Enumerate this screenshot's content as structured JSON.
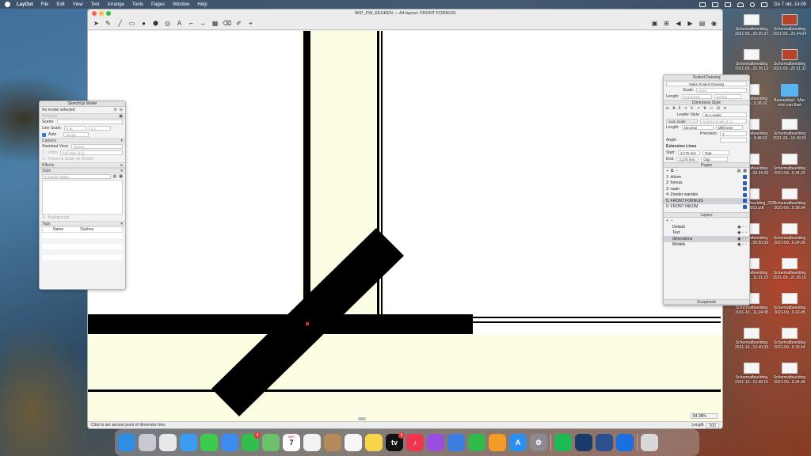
{
  "menubar": {
    "items": [
      "LayOut",
      "File",
      "Edit",
      "View",
      "Text",
      "Arrange",
      "Tools",
      "Pages",
      "Window",
      "Help"
    ],
    "clock": "Do 7 okt.  14:05"
  },
  "window": {
    "title": "SKP_FW_KEUKEN — A4.layout- FRONT FORNUIS",
    "status": "Click to set second point of dimension line.",
    "length_label": "Length",
    "length_value": "600",
    "zoom": "84.98%"
  },
  "sketchup_panel": {
    "title": "SketchUp Model",
    "model_status": "No model selected",
    "viewport": "Viewport",
    "scene_label": "Scene:",
    "line_scale_label": "Line Scale:",
    "line_scale_a": "0 pt",
    "line_scale_b": "1 x",
    "auto_label": "Auto",
    "render_mode": "Vector",
    "camera": "Camera",
    "standard_view_label": "Standard View:",
    "standard_view": "(None)",
    "ortho_label": "Ortho",
    "ortho_value": "Full Size (1:1)",
    "preserve_scale": "Preserve Scale on Resize",
    "effects": "Effects",
    "style": "Style",
    "style_value": "In Model Styles",
    "background": "Background",
    "tags": "Tags",
    "tags_col_name": "Name",
    "tags_col_dashes": "Dashes"
  },
  "scaled_drawing": {
    "title": "Scaled Drawing",
    "button": "Make Scaled Drawing",
    "scale_label": "Scale:",
    "scale_value": "None",
    "length_label": "Length:",
    "length_value": "Fractional",
    "length_unit": "Inches"
  },
  "dimension_style": {
    "title": "Dimension Style",
    "leader_label": "Leader Style:",
    "leader_value": "No Leader",
    "auto_scale": "Auto Scale",
    "current_scale": "Current Scale (1:1)",
    "length_label": "Length:",
    "length_format": "Decimal",
    "length_unit": "Millimeter",
    "precision_label": "Precision:",
    "precision_value": "1",
    "angle_label": "Angle:",
    "ext_title": "Extension Lines",
    "start_label": "Start:",
    "start_value": "3,175 mm",
    "start_mode": "Gap",
    "end_label": "End:",
    "end_value": "3,175 mm",
    "end_mode": "Gap"
  },
  "pages": {
    "title": "Pages",
    "items": [
      {
        "label": "1:  inkom"
      },
      {
        "label": "2:  fornuis"
      },
      {
        "label": "3:  raam"
      },
      {
        "label": "4:  Zonder wanden"
      },
      {
        "label": "5:  FRONT FORNUIS"
      },
      {
        "label": "6:  FRONT INKOM"
      }
    ],
    "selected_index": 4
  },
  "layers": {
    "title": "Layers",
    "items": [
      {
        "label": "Default"
      },
      {
        "label": "Text"
      },
      {
        "label": "dimensions"
      },
      {
        "label": "Models"
      }
    ],
    "selected_index": 2
  },
  "scrapbook": {
    "title": "Scrapbook"
  },
  "desktop_icons": [
    {
      "label": "Schermafbeelding 2021-09...20.35.37",
      "kind": "shot"
    },
    {
      "label": "Schermafbeelding 2021-09...20.34.04",
      "kind": "photo"
    },
    {
      "label": "Schermafbeelding 2021-09...20.36.13",
      "kind": "shot"
    },
    {
      "label": "Schermafbeelding 2021-09...20.51.32",
      "kind": "photo"
    },
    {
      "label": "Schermafbeelding 2021-09...0.38.32",
      "kind": "shot"
    },
    {
      "label": "Bureaublad - Mac mini van Bart",
      "kind": "folder"
    },
    {
      "label": "Schermafbeelding 2021-09...9.48.52",
      "kind": "shot"
    },
    {
      "label": "Schermafbeelding 2021-09...16.38.55",
      "kind": "shot"
    },
    {
      "label": "Schermafbeelding 2021-09...09.34.29",
      "kind": "shot"
    },
    {
      "label": "Schermafbeelding 2021-09...0.34.29",
      "kind": "shot"
    },
    {
      "label": "Schermafbeelding_2021 -09...0013.pdf",
      "kind": "shot"
    },
    {
      "label": "Schermafbeelding 2021-09...0.38.04",
      "kind": "shot"
    },
    {
      "label": "Schermafbeelding 2021-09...09.50.09",
      "kind": "shot"
    },
    {
      "label": "Schermafbeelding 2021-09...0.34.29",
      "kind": "shot"
    },
    {
      "label": "Schermafbeelding 2021-09...11.31.23",
      "kind": "shot"
    },
    {
      "label": "Schermafbeelding 2021-09...21.36.16",
      "kind": "shot"
    },
    {
      "label": "Schermafbeelding 2021-10...11.24.08",
      "kind": "shot"
    },
    {
      "label": "Schermafbeelding 2021-09...0.32.45",
      "kind": "shot"
    },
    {
      "label": "Schermafbeelding 2021-10...13.40.09",
      "kind": "shot"
    },
    {
      "label": "Schermafbeelding 2021-09...0.33.54",
      "kind": "shot"
    },
    {
      "label": "Schermafbeelding 2021-10...13.46.15",
      "kind": "shot"
    },
    {
      "label": "Schermafbeelding 2021-09...0.34.49",
      "kind": "shot"
    }
  ],
  "dock": [
    {
      "name": "finder",
      "color": "#2f8de4",
      "glyph": ""
    },
    {
      "name": "launchpad",
      "color": "#c9c9d4",
      "glyph": ""
    },
    {
      "name": "chrome",
      "color": "#e8e8e8",
      "glyph": ""
    },
    {
      "name": "safari",
      "color": "#3a9bf0",
      "glyph": ""
    },
    {
      "name": "messages",
      "color": "#3ccb4c",
      "glyph": ""
    },
    {
      "name": "mail",
      "color": "#3b8bf0",
      "glyph": ""
    },
    {
      "name": "facetime",
      "color": "#2fbf4a",
      "glyph": "",
      "badge": "1"
    },
    {
      "name": "maps",
      "color": "#6cc26a",
      "glyph": ""
    },
    {
      "name": "calendar",
      "color": "#ffffff",
      "glyph": "7",
      "sub": "OKT"
    },
    {
      "name": "photos",
      "color": "#f2f2f2",
      "glyph": ""
    },
    {
      "name": "contacts",
      "color": "#b48a5a",
      "glyph": ""
    },
    {
      "name": "reminders",
      "color": "#f6f6f6",
      "glyph": ""
    },
    {
      "name": "notes",
      "color": "#f7d44a",
      "glyph": ""
    },
    {
      "name": "tv",
      "color": "#111111",
      "glyph": "tv",
      "badge": "1"
    },
    {
      "name": "music",
      "color": "#f0364e",
      "glyph": "♪"
    },
    {
      "name": "podcasts",
      "color": "#9a4ee0",
      "glyph": ""
    },
    {
      "name": "keynote",
      "color": "#3a7fe0",
      "glyph": ""
    },
    {
      "name": "numbers",
      "color": "#2fba4a",
      "glyph": ""
    },
    {
      "name": "pages",
      "color": "#f39c2a",
      "glyph": ""
    },
    {
      "name": "app-store",
      "color": "#2a8ff0",
      "glyph": "A"
    },
    {
      "name": "system-preferences",
      "color": "#8a8a8f",
      "glyph": "⚙"
    },
    {
      "name": "spotify",
      "color": "#1db954",
      "glyph": ""
    },
    {
      "name": "sketchup",
      "color": "#1a3a6a",
      "glyph": ""
    },
    {
      "name": "layout",
      "color": "#2b4f8f",
      "glyph": ""
    },
    {
      "name": "teamviewer",
      "color": "#1a70e0",
      "glyph": ""
    },
    {
      "name": "trash",
      "color": "#d8d8d8",
      "glyph": ""
    }
  ]
}
